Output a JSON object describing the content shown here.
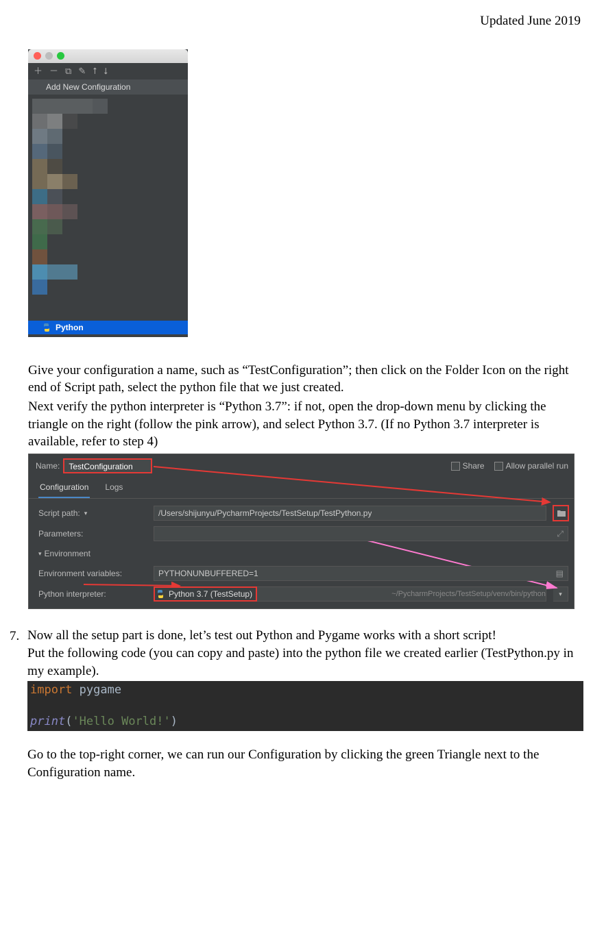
{
  "header": {
    "date": "Updated June 2019"
  },
  "ss1": {
    "header": "Add New Configuration",
    "python_label": "Python"
  },
  "body": {
    "p1": "Give your configuration a name, such as “TestConfiguration”; then click on the Folder Icon on the right end of Script path, select the python file that we just created.",
    "p2": "Next verify the python interpreter is “Python 3.7”: if not, open the drop-down menu by clicking the triangle on the right (follow the pink arrow), and select Python 3.7. (If no Python 3.7 interpreter is available, refer to step 4)"
  },
  "ss2": {
    "name_label": "Name:",
    "name_value": "TestConfiguration",
    "share": "Share",
    "allow_parallel": "Allow parallel run",
    "tab_config": "Configuration",
    "tab_logs": "Logs",
    "script_path_label": "Script path:",
    "script_path_value": "/Users/shijunyu/PycharmProjects/TestSetup/TestPython.py",
    "parameters_label": "Parameters:",
    "parameters_value": "",
    "env_header": "Environment",
    "env_vars_label": "Environment variables:",
    "env_vars_value": "PYTHONUNBUFFERED=1",
    "interpreter_label": "Python interpreter:",
    "interpreter_badge": "Python 3.7 (TestSetup)",
    "interpreter_path": "~/PycharmProjects/TestSetup/venv/bin/python"
  },
  "step7": {
    "num": "7.",
    "p1": "Now all the setup part is done, let’s test out Python and Pygame works with a short script!",
    "p2": "Put the following code (you can copy and paste) into the python file we created earlier (TestPython.py in my example)."
  },
  "code": {
    "import_kw": "import",
    "module": "pygame",
    "func": "print",
    "open": "(",
    "str": "'Hello World!'",
    "close": ")"
  },
  "footer": {
    "p1": "Go to the top-right corner, we can run our Configuration by clicking the green Triangle next to the Configuration name."
  },
  "pixels": [
    "#5a5e60",
    "#5a5e60",
    "#5a5e60",
    "#5a5e60",
    "#53575a",
    "#3c3f41",
    "#6d6f71",
    "#7d7f80",
    "#48494a",
    "#3c3f41",
    "#3c3f41",
    "#3c3f41",
    "#6f7a83",
    "#5f6a72",
    "#3c3f41",
    "#3c3f41",
    "#3c3f41",
    "#3c3f41",
    "#55687a",
    "#49555f",
    "#3c3f41",
    "#3c3f41",
    "#3c3f41",
    "#3c3f41",
    "#756a55",
    "#4e4b44",
    "#3c3f41",
    "#3c3f41",
    "#3c3f41",
    "#3c3f41",
    "#756a55",
    "#8a7f69",
    "#6b6150",
    "#3c3f41",
    "#3c3f41",
    "#3c3f41",
    "#3d6d86",
    "#4b5057",
    "#3c3f41",
    "#3c3f41",
    "#3c3f41",
    "#3c3f41",
    "#7a5f60",
    "#6e5859",
    "#5d5253",
    "#3c3f41",
    "#3c3f41",
    "#3c3f41",
    "#486a4e",
    "#4a5a4c",
    "#3c3f41",
    "#3c3f41",
    "#3c3f41",
    "#3c3f41",
    "#3f6a4a",
    "#3c3f41",
    "#3c3f41",
    "#3c3f41",
    "#3c3f41",
    "#3c3f41",
    "#70523e",
    "#3c3f41",
    "#3c3f41",
    "#3c3f41",
    "#3c3f41",
    "#3c3f41",
    "#4d8db0",
    "#517a90",
    "#517a90",
    "#3c3f41",
    "#3c3f41",
    "#3c3f41",
    "#396b9e",
    "#3c3f41",
    "#3c3f41",
    "#3c3f41",
    "#3c3f41",
    "#3c3f41"
  ]
}
